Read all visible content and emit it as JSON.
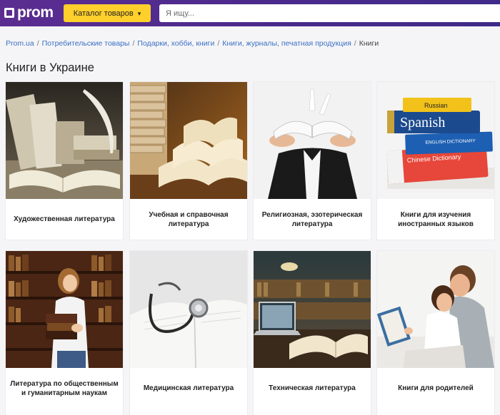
{
  "header": {
    "logo_text": "prom",
    "catalog_label": "Каталог товаров",
    "search_placeholder": "Я ищу..."
  },
  "breadcrumb": {
    "items": [
      "Prom.ua",
      "Потребительские товары",
      "Подарки, хобби, книги",
      "Книги, журналы, печатная продукция"
    ],
    "current": "Книги",
    "separator": "/"
  },
  "page_title": "Книги в Украине",
  "categories": [
    {
      "label": "Художественная литература",
      "image": "old-books-quill"
    },
    {
      "label": "Учебная и справочная литература",
      "image": "open-book-stack"
    },
    {
      "label": "Религиозная, эзотерическая литература",
      "image": "hands-open-book"
    },
    {
      "label": "Книги для изучения иностранных языков",
      "image": "language-dictionaries"
    },
    {
      "label": "Литература по общественным и гуманитарным наукам",
      "image": "woman-with-books-library"
    },
    {
      "label": "Медицинская литература",
      "image": "stethoscope-on-book"
    },
    {
      "label": "Техническая литература",
      "image": "laptop-open-book"
    },
    {
      "label": "Книги для родителей",
      "image": "couple-reading"
    }
  ],
  "image_text": {
    "spanish": "Spanish",
    "russian": "Russian",
    "english": "ENGLISH DICTIONARY",
    "chinese": "Chinese Dictionary"
  },
  "colors": {
    "header_bg": "#4a2a8c",
    "catalog_button": "#ffcf2b",
    "link": "#3b6fc4",
    "page_bg": "#f5f5f7"
  }
}
